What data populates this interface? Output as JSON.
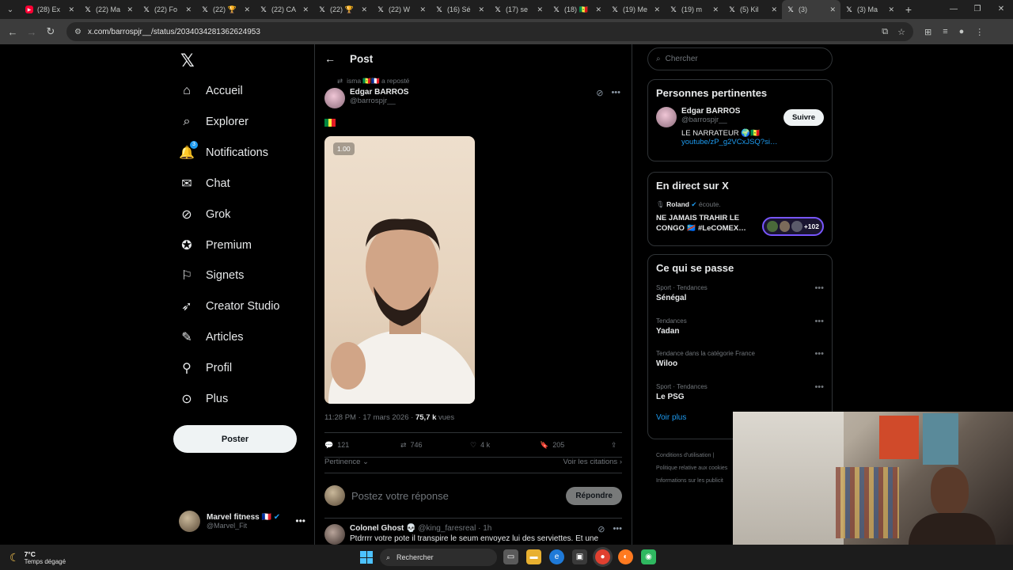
{
  "browser": {
    "tabs": [
      {
        "label": "(28) Ex",
        "favicon": "youtube-icon"
      },
      {
        "label": "(22) Ma",
        "favicon": "x-icon"
      },
      {
        "label": "(22) Fo",
        "favicon": "x-icon"
      },
      {
        "label": "(22) 🏆",
        "favicon": "x-icon"
      },
      {
        "label": "(22) CA",
        "favicon": "x-icon"
      },
      {
        "label": "(22) 🏆",
        "favicon": "x-icon"
      },
      {
        "label": "(22) W",
        "favicon": "x-icon"
      },
      {
        "label": "(16) Sé",
        "favicon": "x-icon"
      },
      {
        "label": "(17) se",
        "favicon": "x-icon"
      },
      {
        "label": "(18) 🇸🇳",
        "favicon": "x-icon"
      },
      {
        "label": "(19) Me",
        "favicon": "x-icon"
      },
      {
        "label": "(19) m",
        "favicon": "x-icon"
      },
      {
        "label": "(5) Kil",
        "favicon": "x-icon"
      },
      {
        "label": "(3)",
        "favicon": "x-icon",
        "active": true
      },
      {
        "label": "(3) Ma",
        "favicon": "x-icon"
      }
    ],
    "new_tab": "+",
    "url": "x.com/barrospjr__/status/2034034281362624953"
  },
  "nav": {
    "logo": "𝕏",
    "items": [
      {
        "label": "Accueil",
        "icon": "home-icon"
      },
      {
        "label": "Explorer",
        "icon": "search-icon"
      },
      {
        "label": "Notifications",
        "icon": "bell-icon",
        "badge": "3"
      },
      {
        "label": "Chat",
        "icon": "mail-icon"
      },
      {
        "label": "Grok",
        "icon": "grok-icon"
      },
      {
        "label": "Premium",
        "icon": "verified-icon"
      },
      {
        "label": "Signets",
        "icon": "bookmark-icon"
      },
      {
        "label": "Creator Studio",
        "icon": "rocket-icon"
      },
      {
        "label": "Articles",
        "icon": "article-icon"
      },
      {
        "label": "Profil",
        "icon": "person-icon"
      },
      {
        "label": "Plus",
        "icon": "more-circle-icon"
      }
    ],
    "post_button": "Poster",
    "account": {
      "name": "Marvel fitness 🇫🇷",
      "handle": "@Marvel_Fit"
    }
  },
  "post": {
    "header_title": "Post",
    "repost_by": "isma 🇸🇳🇫🇷 a reposté",
    "author_name": "Edgar BARROS",
    "author_handle": "@barrospjr__",
    "speed": "1.00",
    "time": "11:28 PM · 17 mars 2026 · ",
    "views_count": "75,7 k",
    "views_label": " vues",
    "stats": {
      "replies": "121",
      "reposts": "746",
      "likes": "4 k",
      "bookmarks": "205"
    },
    "sort_label": "Pertinence",
    "quotes_label": "Voir les citations",
    "reply_placeholder": "Postez votre réponse",
    "reply_button": "Répondre"
  },
  "first_reply": {
    "name": "Colonel Ghost 💀",
    "handle": "@king_faresreal",
    "time": "· 1h",
    "text": "Ptdrrrr votre pote il transpire le seum envoyez lui des serviettes. Et une"
  },
  "right": {
    "search_placeholder": "Chercher",
    "relevant": {
      "title": "Personnes pertinentes",
      "name": "Edgar BARROS",
      "handle": "@barrospjr__",
      "bio": "LE NARRATEUR 🌍🇸🇳",
      "link": "youtube/zP_g2VCxJSQ?si…",
      "follow": "Suivre"
    },
    "live": {
      "title": "En direct sur X",
      "host": "Roland",
      "host_suffix": " écoute.",
      "room": "NE JAMAIS TRAHIR LE CONGO 🇨🇩 #LeCOMEX…",
      "listeners": "+102"
    },
    "trends": {
      "title": "Ce qui se passe",
      "items": [
        {
          "category": "Sport · Tendances",
          "name": "Sénégal"
        },
        {
          "category": "Tendances",
          "name": "Yadan"
        },
        {
          "category": "Tendance dans la catégorie France",
          "name": "Wiloo"
        },
        {
          "category": "Sport · Tendances",
          "name": "Le PSG"
        }
      ],
      "show_more": "Voir plus"
    },
    "footer": [
      "Conditions d'utilisation  |",
      "Politique relative aux cookies",
      "Informations sur les publicit"
    ]
  },
  "taskbar": {
    "temperature": "7°C",
    "weather": "Temps dégagé",
    "search": "Rechercher"
  },
  "colors": {
    "accent": "#1d9bf0",
    "background": "#000000",
    "live_border": "#7856ff"
  }
}
